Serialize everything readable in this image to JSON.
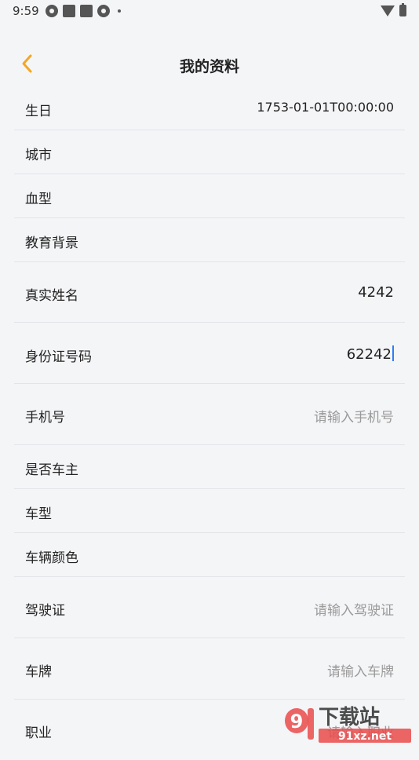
{
  "status": {
    "time": "9:59"
  },
  "header": {
    "title": "我的资料"
  },
  "rows": [
    {
      "label": "生日",
      "value": "1753-01-01T00:00:00"
    },
    {
      "label": "城市",
      "value": ""
    },
    {
      "label": "血型",
      "value": ""
    },
    {
      "label": "教育背景",
      "value": ""
    },
    {
      "label": "真实姓名",
      "value": "4242"
    },
    {
      "label": "身份证号码",
      "value": "62242"
    },
    {
      "label": "手机号",
      "placeholder": "请输入手机号"
    },
    {
      "label": "是否车主",
      "value": ""
    },
    {
      "label": "车型",
      "value": ""
    },
    {
      "label": "车辆颜色",
      "value": ""
    },
    {
      "label": "驾驶证",
      "placeholder": "请输入驾驶证"
    },
    {
      "label": "车牌",
      "placeholder": "请输入车牌"
    },
    {
      "label": "职业",
      "placeholder": "请输入职业"
    }
  ],
  "watermark": {
    "text": "下载站",
    "url_text": "91xz.net"
  },
  "colors": {
    "accent": "#f5a623",
    "background": "#f4f5f7",
    "placeholder": "#9a9a9a",
    "cursor": "#2f7cf6"
  }
}
